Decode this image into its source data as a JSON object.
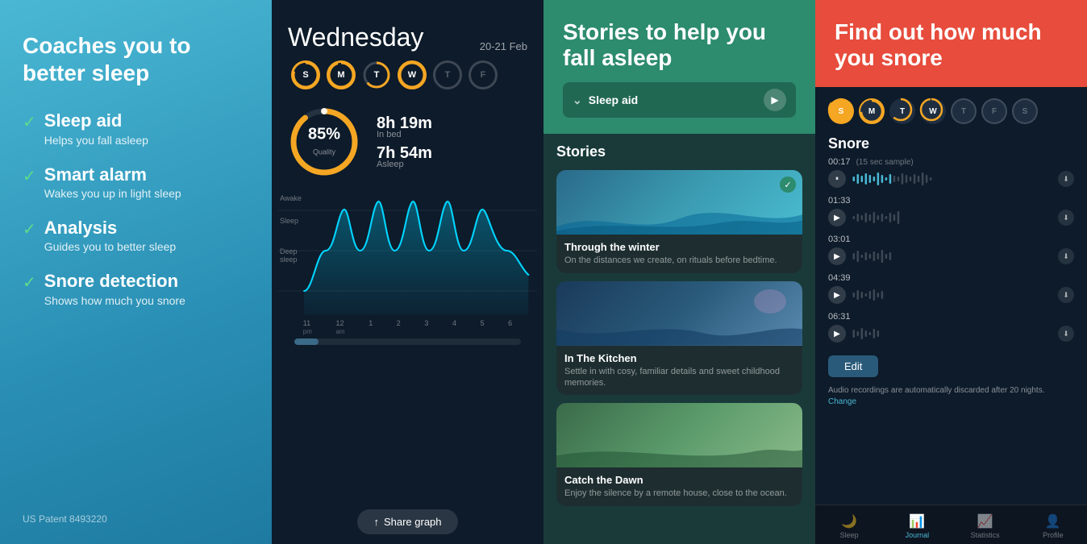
{
  "panel1": {
    "title": "Coaches you to better sleep",
    "features": [
      {
        "title": "Sleep aid",
        "desc": "Helps you fall asleep"
      },
      {
        "title": "Smart alarm",
        "desc": "Wakes you up in light sleep"
      },
      {
        "title": "Analysis",
        "desc": "Guides you to better sleep"
      },
      {
        "title": "Snore detection",
        "desc": "Shows how much you snore"
      }
    ],
    "patent": "US Patent 8493220"
  },
  "panel2": {
    "day": "Wednesday",
    "date": "20-21 Feb",
    "day_circles": [
      {
        "label": "S",
        "state": "active"
      },
      {
        "label": "M",
        "state": "active"
      },
      {
        "label": "T",
        "state": "semi"
      },
      {
        "label": "W",
        "state": "active"
      },
      {
        "label": "T",
        "state": "dim"
      },
      {
        "label": "F",
        "state": "dim"
      }
    ],
    "quality_pct": "85%",
    "quality_label": "Quality",
    "inbed": "8h 19m",
    "inbed_label": "In bed",
    "asleep": "7h 54m",
    "asleep_label": "Asleep",
    "graph_labels": [
      "Awake",
      "Sleep",
      "Deep sleep"
    ],
    "x_ticks": [
      "11",
      "12",
      "1",
      "2",
      "3",
      "4",
      "5",
      "6"
    ],
    "x_subs": [
      "pm",
      "am"
    ],
    "share_label": "Share graph"
  },
  "panel3": {
    "top_title": "Stories to help you fall asleep",
    "bar_label": "Sleep aid",
    "stories_title": "Stories",
    "stories": [
      {
        "name": "Through the winter",
        "desc": "On the distances we create, on rituals before bedtime.",
        "has_check": true,
        "color": "bg1"
      },
      {
        "name": "In The Kitchen",
        "desc": "Settle in with cosy, familiar details and sweet childhood memories.",
        "has_check": false,
        "color": "bg2"
      },
      {
        "name": "Catch the Dawn",
        "desc": "Enjoy the silence by a remote house, close to the ocean.",
        "has_check": false,
        "color": "bg3"
      }
    ]
  },
  "panel4": {
    "top_title": "Find out how much you snore",
    "week_circles": [
      {
        "label": "S",
        "active": true
      },
      {
        "label": "M",
        "active": true
      },
      {
        "label": "T",
        "active": true
      },
      {
        "label": "W",
        "active": true
      },
      {
        "label": "T",
        "active": false
      },
      {
        "label": "F",
        "active": false
      },
      {
        "label": "S",
        "active": false
      }
    ],
    "snore_title": "Snore",
    "recordings": [
      {
        "time": "00:17",
        "note": "(15 sec sample)",
        "playing": true
      },
      {
        "time": "01:33",
        "note": "",
        "playing": false
      },
      {
        "time": "03:01",
        "note": "",
        "playing": false
      },
      {
        "time": "04:39",
        "note": "",
        "playing": false
      },
      {
        "time": "06:31",
        "note": "",
        "playing": false
      }
    ],
    "edit_label": "Edit",
    "audio_note": "Audio recordings are automatically discarded after 20 nights.",
    "audio_change": "Change",
    "nav_items": [
      {
        "icon": "🌙",
        "label": "Sleep",
        "active": false
      },
      {
        "icon": "📊",
        "label": "Journal",
        "active": true
      },
      {
        "icon": "📈",
        "label": "Statistics",
        "active": false
      },
      {
        "icon": "👤",
        "label": "Profile",
        "active": false
      }
    ]
  }
}
